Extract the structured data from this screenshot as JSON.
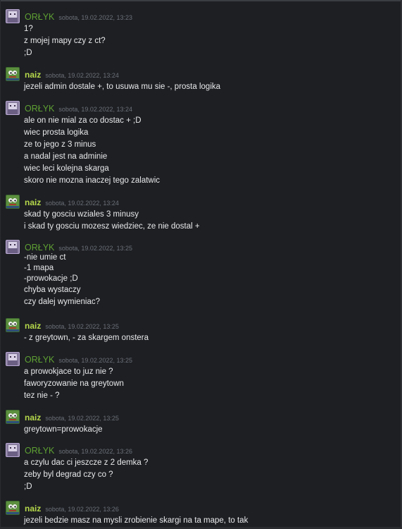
{
  "messages": [
    {
      "author": "ORŁYK",
      "time": "sobota, 19.02.2022, 13:23",
      "lines": [
        "1?",
        "z mojej mapy czy z ct?",
        ";D"
      ]
    },
    {
      "author": "naiz",
      "time": "sobota, 19.02.2022, 13:24",
      "lines": [
        "jezeli admin dostale +, to usuwa mu sie -, prosta logika"
      ]
    },
    {
      "author": "ORŁYK",
      "time": "sobota, 19.02.2022, 13:24",
      "lines": [
        "ale on nie mial za co dostac + ;D",
        "wiec prosta logika",
        "ze to jego z 3 minus",
        "a nadal jest na adminie",
        "wiec leci kolejna skarga",
        "skoro nie mozna inaczej tego zalatwic"
      ]
    },
    {
      "author": "naiz",
      "time": "sobota, 19.02.2022, 13:24",
      "lines": [
        "skad ty gosciu wziales 3 minusy",
        "i skad ty gosciu mozesz wiedziec, ze nie dostal +"
      ]
    },
    {
      "author": "ORŁYK",
      "time": "sobota, 19.02.2022, 13:25",
      "lines": [
        "-nie umie ct",
        "-1 mapa",
        "-prowokacje ;D",
        "chyba wystaczy",
        "czy dalej wymieniac?"
      ]
    },
    {
      "author": "naiz",
      "time": "sobota, 19.02.2022, 13:25",
      "lines": [
        "- z greytown, - za skargem onstera"
      ]
    },
    {
      "author": "ORŁYK",
      "time": "sobota, 19.02.2022, 13:25",
      "lines": [
        "a prowokjace to juz nie ?",
        "faworyzowanie na greytown",
        "tez nie - ?"
      ]
    },
    {
      "author": "naiz",
      "time": "sobota, 19.02.2022, 13:25",
      "lines": [
        "greytown=prowokacje"
      ]
    },
    {
      "author": "ORŁYK",
      "time": "sobota, 19.02.2022, 13:26",
      "lines": [
        "a czylu dac ci jeszcze z 2 demka ?",
        "zeby byl degrad czy co ?",
        ";D"
      ]
    },
    {
      "author": "naiz",
      "time": "sobota, 19.02.2022, 13:26",
      "lines": [
        "jezeli bedzie masz na mysli zrobienie skargi na ta mape, to tak"
      ]
    }
  ],
  "colors": {
    "background": "#1d1f23",
    "orlyk_name": "#5fa033",
    "naiz_name": "#b6d84b",
    "timestamp": "#6c7078",
    "text": "#e8e9ea"
  },
  "icons": {
    "orlyk_avatar": "avatar-orlyk-icon",
    "naiz_avatar": "avatar-naiz-frog-icon"
  }
}
